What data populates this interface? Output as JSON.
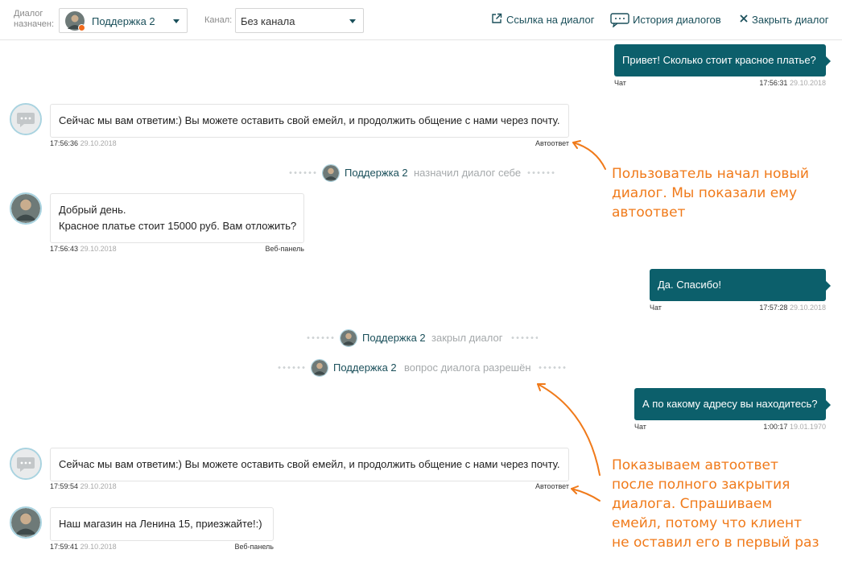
{
  "header": {
    "assigned_label_1": "Диалог",
    "assigned_label_2": "назначен:",
    "agent_select_value": "Поддержка 2",
    "channel_label": "Канал:",
    "channel_select_value": "Без канала",
    "link_label": "Ссылка на диалог",
    "history_label": "История диалогов",
    "close_label": "Закрыть диалог"
  },
  "messages": {
    "m1": {
      "text": "Привет! Сколько стоит красное платье?",
      "source": "Чат",
      "time": "17:56:31",
      "date": "29.10.2018"
    },
    "m2": {
      "text": "Сейчас мы вам ответим:) Вы можете оставить свой емейл, и продолжить общение с нами через почту.",
      "source": "Автоответ",
      "time": "17:56:36",
      "date": "29.10.2018"
    },
    "m3": {
      "line1": "Добрый день.",
      "line2": "Красное платье стоит 15000 руб. Вам отложить?",
      "source": "Веб-панель",
      "time": "17:56:43",
      "date": "29.10.2018"
    },
    "m4": {
      "text": "Да. Спасибо!",
      "source": "Чат",
      "time": "17:57:28",
      "date": "29.10.2018"
    },
    "m5": {
      "text": "А по какому адресу вы находитесь?",
      "source": "Чат",
      "time": "1:00:17",
      "date": "19.01.1970"
    },
    "m6": {
      "text": "Сейчас мы вам ответим:) Вы можете оставить свой емейл, и продолжить общение с нами через почту.",
      "source": "Автоответ",
      "time": "17:59:54",
      "date": "29.10.2018"
    },
    "m7": {
      "text": "Наш магазин на Ленина 15, приезжайте!:)",
      "source": "Веб-панель",
      "time": "17:59:41",
      "date": "29.10.2018"
    }
  },
  "events": {
    "e1": {
      "who": "Поддержка 2",
      "what": "назначил диалог себе"
    },
    "e2": {
      "who": "Поддержка 2",
      "what": "закрыл диалог"
    },
    "e3": {
      "who": "Поддержка 2",
      "what": "вопрос диалога разрешён"
    }
  },
  "annotations": {
    "a1": [
      "Пользователь начал новый",
      "диалог. Мы показали ему",
      "автоответ"
    ],
    "a2": [
      "Показываем автоответ",
      "после полного закрытия",
      "диалога. Спрашиваем",
      "емейл, потому что клиент",
      "не оставил его в первый раз"
    ]
  },
  "colors": {
    "accent": "#0c5f6b",
    "annotation": "#f07a1a",
    "status_dot": "#f26a1b"
  },
  "icons": [
    "external-link-icon",
    "chat-history-icon",
    "close-icon",
    "chevron-down-icon",
    "bot-chat-icon",
    "agent-avatar"
  ]
}
